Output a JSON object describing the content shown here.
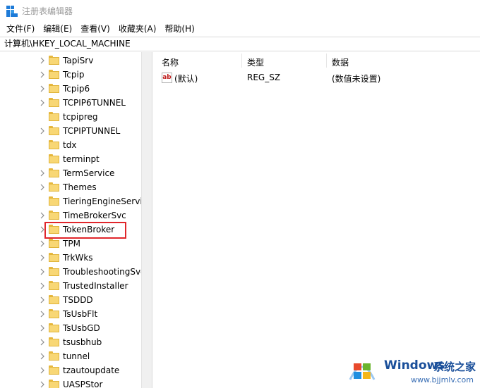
{
  "window": {
    "title": "注册表编辑器"
  },
  "menu": [
    "文件(F)",
    "编辑(E)",
    "查看(V)",
    "收藏夹(A)",
    "帮助(H)"
  ],
  "address": "计算机\\HKEY_LOCAL_MACHINE",
  "tree": {
    "items": [
      {
        "label": "TapiSrv",
        "expandable": true
      },
      {
        "label": "Tcpip",
        "expandable": true
      },
      {
        "label": "Tcpip6",
        "expandable": true
      },
      {
        "label": "TCPIP6TUNNEL",
        "expandable": true
      },
      {
        "label": "tcpipreg",
        "expandable": false
      },
      {
        "label": "TCPIPTUNNEL",
        "expandable": true
      },
      {
        "label": "tdx",
        "expandable": false
      },
      {
        "label": "terminpt",
        "expandable": false
      },
      {
        "label": "TermService",
        "expandable": true
      },
      {
        "label": "Themes",
        "expandable": true
      },
      {
        "label": "TieringEngineService",
        "expandable": false
      },
      {
        "label": "TimeBrokerSvc",
        "expandable": true
      },
      {
        "label": "TokenBroker",
        "expandable": true,
        "highlighted": true
      },
      {
        "label": "TPM",
        "expandable": true
      },
      {
        "label": "TrkWks",
        "expandable": true
      },
      {
        "label": "TroubleshootingSvc",
        "expandable": true
      },
      {
        "label": "TrustedInstaller",
        "expandable": true
      },
      {
        "label": "TSDDD",
        "expandable": true
      },
      {
        "label": "TsUsbFlt",
        "expandable": true
      },
      {
        "label": "TsUsbGD",
        "expandable": true
      },
      {
        "label": "tsusbhub",
        "expandable": true
      },
      {
        "label": "tunnel",
        "expandable": true
      },
      {
        "label": "tzautoupdate",
        "expandable": true
      },
      {
        "label": "UASPStor",
        "expandable": true
      }
    ]
  },
  "list": {
    "columns": {
      "name": "名称",
      "type": "类型",
      "data": "数据"
    },
    "rows": [
      {
        "name": "(默认)",
        "type": "REG_SZ",
        "data": "(数值未设置)",
        "icon": "ab"
      }
    ]
  },
  "watermark": {
    "brand": "Windows",
    "site_cn": "系统之家",
    "url": "www.bjjmlv.com"
  }
}
